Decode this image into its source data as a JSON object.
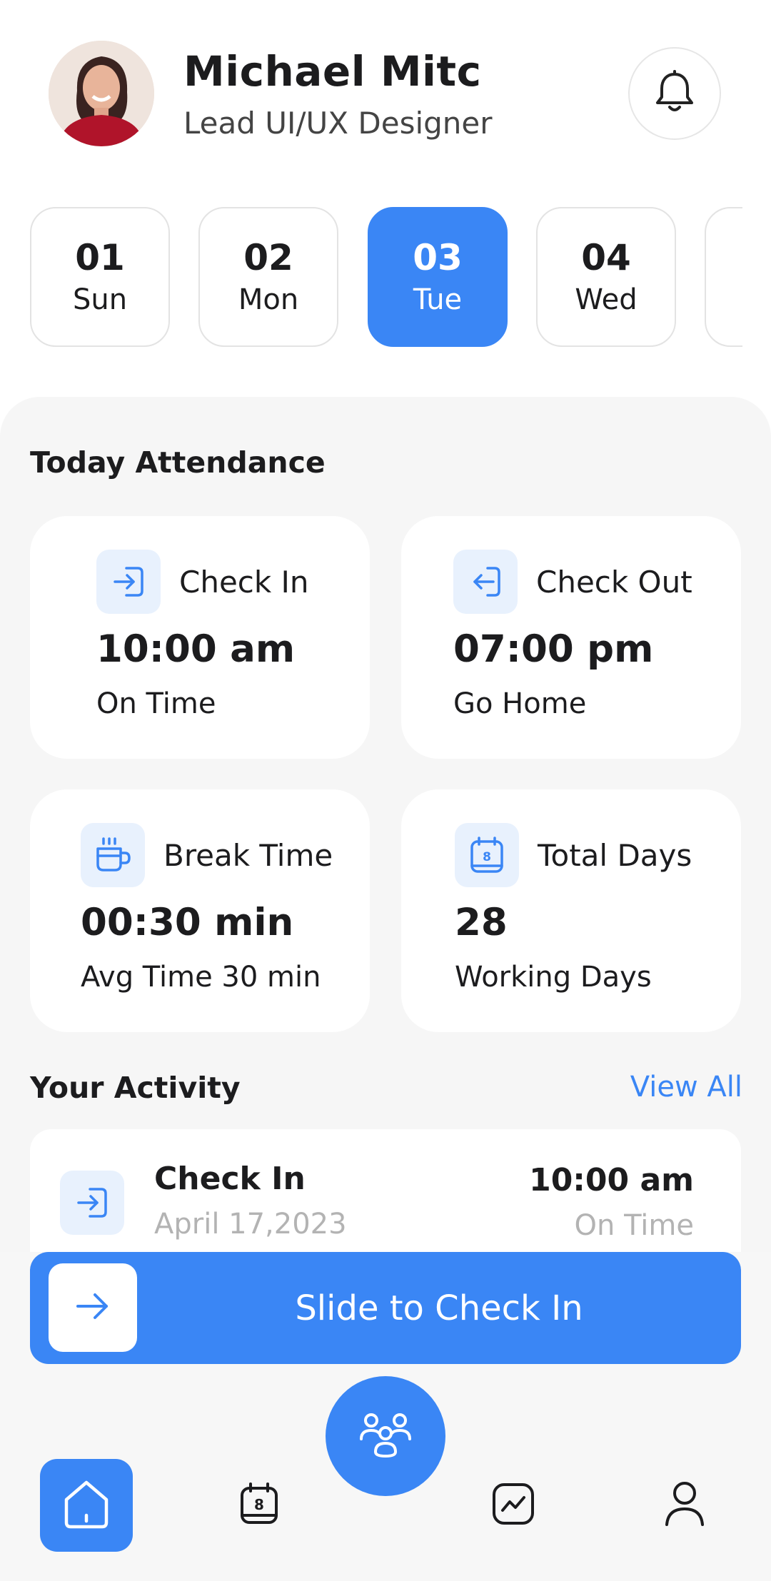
{
  "header": {
    "name": "Michael Mitc",
    "role": "Lead UI/UX Designer"
  },
  "dates": [
    {
      "num": "01",
      "day": "Sun",
      "active": false
    },
    {
      "num": "02",
      "day": "Mon",
      "active": false
    },
    {
      "num": "03",
      "day": "Tue",
      "active": true
    },
    {
      "num": "04",
      "day": "Wed",
      "active": false
    }
  ],
  "attendance": {
    "title": "Today Attendance",
    "check_in": {
      "label": "Check In",
      "value": "10:00 am",
      "sub": "On Time"
    },
    "check_out": {
      "label": "Check Out",
      "value": "07:00 pm",
      "sub": "Go Home"
    },
    "break_time": {
      "label": "Break Time",
      "value": "00:30 min",
      "sub": "Avg Time 30 min"
    },
    "total_days": {
      "label": "Total Days",
      "value": "28",
      "sub": "Working Days",
      "icon_number": "8"
    }
  },
  "activity": {
    "title": "Your Activity",
    "view_all": "View All",
    "items": [
      {
        "title": "Check In",
        "date": "April 17,2023",
        "time": "10:00 am",
        "status": "On Time"
      }
    ]
  },
  "slide": {
    "label": "Slide to Check In"
  },
  "nav": {
    "calendar_number": "8",
    "items": [
      "home-icon",
      "calendar-icon",
      "team-icon",
      "chart-icon",
      "profile-icon"
    ]
  },
  "colors": {
    "accent": "#3a86f5",
    "icon_bg": "#e8f1fd",
    "panel_bg": "#f6f6f6",
    "muted_text": "#b3b3b3"
  }
}
